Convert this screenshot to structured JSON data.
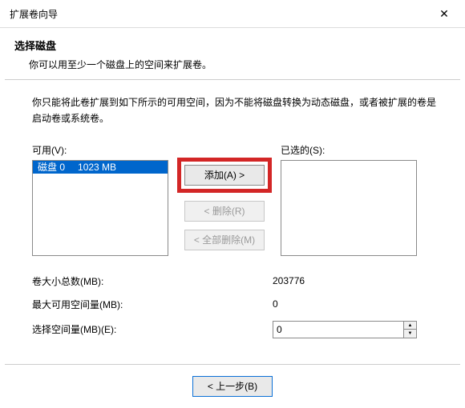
{
  "window": {
    "title": "扩展卷向导"
  },
  "header": {
    "title": "选择磁盘",
    "subtitle": "你可以用至少一个磁盘上的空间来扩展卷。"
  },
  "description": "你只能将此卷扩展到如下所示的可用空间，因为不能将磁盘转换为动态磁盘，或者被扩展的卷是启动卷或系统卷。",
  "available": {
    "label": "可用(V):",
    "items": [
      {
        "name": "磁盘 0",
        "size": "1023 MB",
        "selected": true
      }
    ]
  },
  "selected": {
    "label": "已选的(S):",
    "items": []
  },
  "buttons": {
    "add": "添加(A) >",
    "remove": "< 删除(R)",
    "remove_all": "< 全部删除(M)",
    "back": "< 上一步(B)"
  },
  "fields": {
    "total": {
      "label": "卷大小总数(MB):",
      "value": "203776"
    },
    "max": {
      "label": "最大可用空间量(MB):",
      "value": "0"
    },
    "select": {
      "label": "选择空间量(MB)(E):",
      "value": "0"
    }
  }
}
